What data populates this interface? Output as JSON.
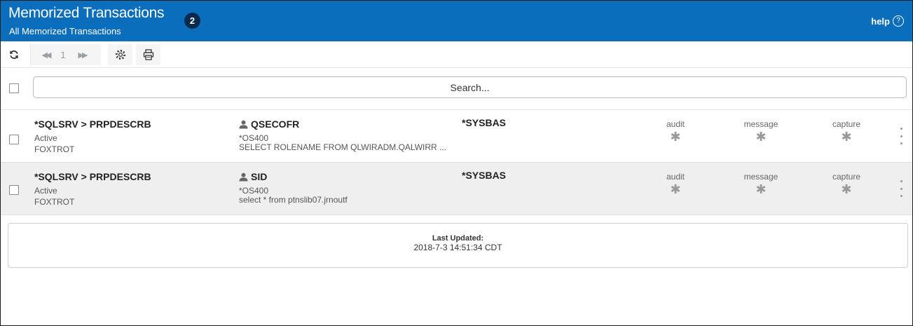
{
  "header": {
    "title": "Memorized Transactions",
    "subtitle": "All Memorized Transactions",
    "count": "2",
    "help_label": "help",
    "help_icon_glyph": "?",
    "color": "#0a6ebd"
  },
  "toolbar": {
    "refresh_icon": "refresh-icon",
    "pager": {
      "first_glyph": "◀◀",
      "page": "1",
      "next_glyph": "▶▶"
    },
    "settings_icon": "gear-icon",
    "print_icon": "printer-icon"
  },
  "search": {
    "placeholder": "Search..."
  },
  "rows": [
    {
      "name": "*SQLSRV > PRPDESCRB",
      "status": "Active",
      "system": "FOXTROT",
      "user": "QSECOFR",
      "user_type": "*OS400",
      "sql": "SELECT ROLENAME FROM QLWIRADM.QALWIRR ...",
      "asp": "*SYSBAS",
      "flags": [
        {
          "label": "audit",
          "glyph": "✱"
        },
        {
          "label": "message",
          "glyph": "✱"
        },
        {
          "label": "capture",
          "glyph": "✱"
        }
      ]
    },
    {
      "name": "*SQLSRV > PRPDESCRB",
      "status": "Active",
      "system": "FOXTROT",
      "user": "SID",
      "user_type": "*OS400",
      "sql": "select * from ptnslib07.jrnoutf",
      "asp": "*SYSBAS",
      "flags": [
        {
          "label": "audit",
          "glyph": "✱"
        },
        {
          "label": "message",
          "glyph": "✱"
        },
        {
          "label": "capture",
          "glyph": "✱"
        }
      ]
    }
  ],
  "footer": {
    "last_updated_label": "Last Updated:",
    "last_updated_value": "2018-7-3 14:51:34 CDT"
  }
}
